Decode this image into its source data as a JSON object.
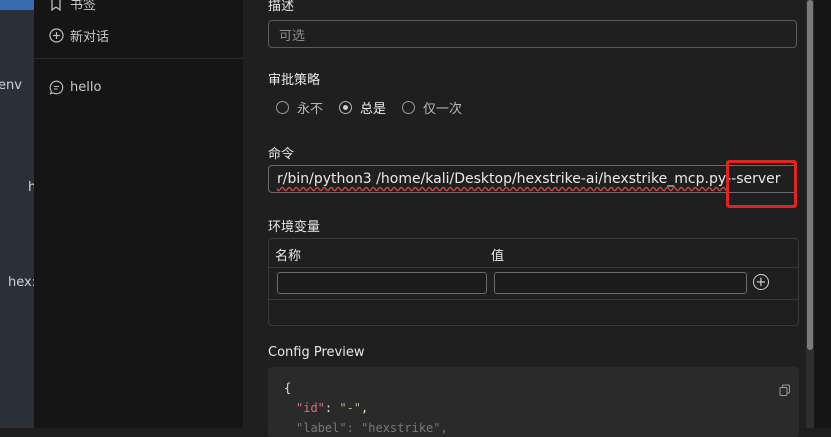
{
  "left_strip": {
    "texts": [
      "env",
      "h",
      "hex:"
    ]
  },
  "sidebar": {
    "bookmarks_label": "书签",
    "new_chat_label": "新对话",
    "chat_item_label": "hello"
  },
  "form": {
    "description": {
      "label": "描述",
      "placeholder": "可选"
    },
    "approval": {
      "label": "审批策略",
      "options": [
        "永不",
        "总是",
        "仅一次"
      ],
      "selected": "总是"
    },
    "command": {
      "label": "命令",
      "value_underlined": "r/bin/python3 /home/kali/Desktop/hexstrike-ai/hexstrike_mcp.py",
      "value_tail": " --server"
    },
    "env": {
      "label": "环境变量",
      "col_name": "名称",
      "col_value": "值",
      "name_value": "",
      "value_value": ""
    },
    "config_preview": {
      "label": "Config Preview",
      "line1": "{",
      "id_key": "\"id\"",
      "id_value": "\"-\"",
      "line3_partial": "\"label\": \"hexstrike\","
    }
  },
  "icons": [
    "bookmark-icon",
    "plus-circle-icon",
    "chat-bubble-icon",
    "copy-icon",
    "add-circle-icon"
  ],
  "colors": {
    "highlight": "#e02424",
    "strip_accent": "#3a6db0"
  }
}
